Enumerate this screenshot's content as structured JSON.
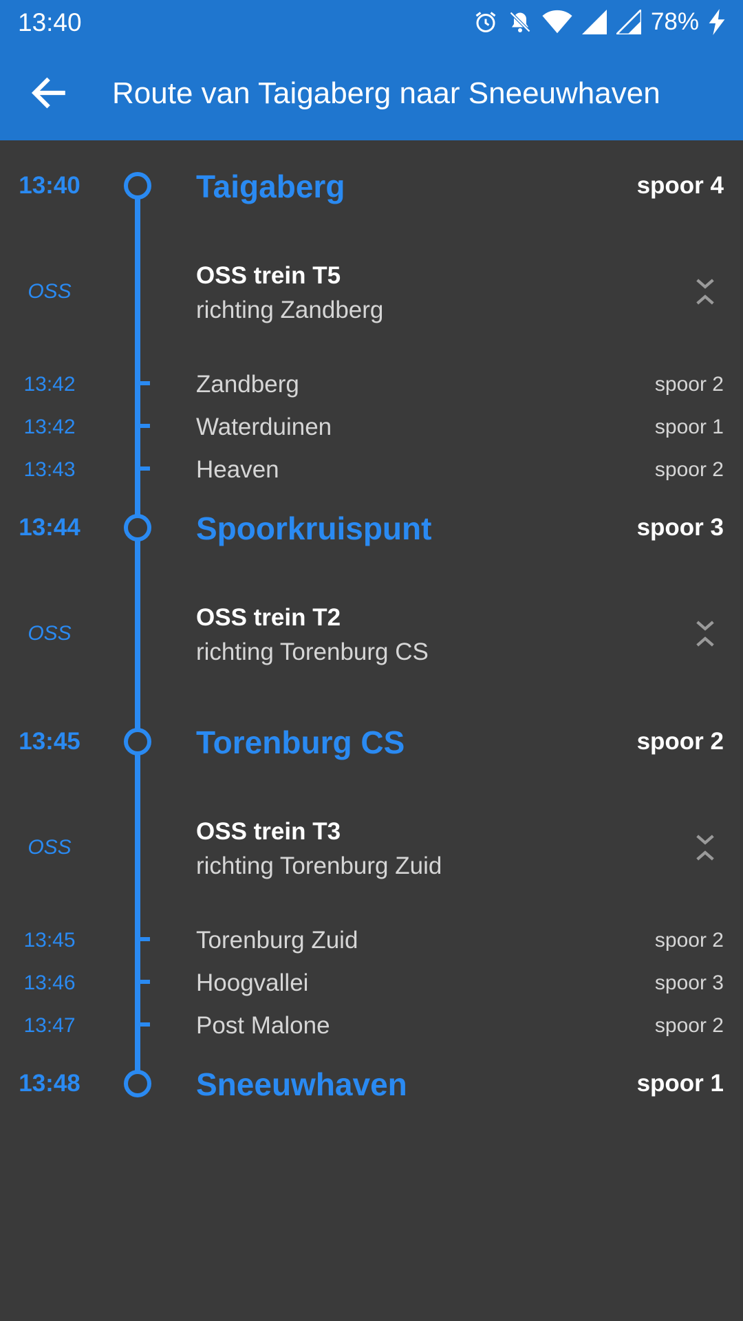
{
  "status_bar": {
    "time": "13:40",
    "battery_percent": "78%",
    "icons": [
      "alarm-icon",
      "bell-off-icon",
      "wifi-icon",
      "signal-icon",
      "signal-icon",
      "charging-icon"
    ]
  },
  "app_bar": {
    "title": "Route van Taigaberg naar Sneeuwhaven",
    "back_icon": "arrow-left-icon"
  },
  "colors": {
    "app_bar": "#1f76cf",
    "accent": "#2a8af2",
    "background": "#3a3a3a",
    "text_primary": "#ffffff",
    "text_secondary": "#d6d6d6"
  },
  "route": {
    "stop1": {
      "time": "13:40",
      "name": "Taigaberg",
      "platform": "spoor 4"
    },
    "leg1": {
      "operator": "OSS",
      "train": "OSS trein T5",
      "direction": "richting Zandberg",
      "stops": [
        {
          "time": "13:42",
          "name": "Zandberg",
          "platform": "spoor 2"
        },
        {
          "time": "13:42",
          "name": "Waterduinen",
          "platform": "spoor 1"
        },
        {
          "time": "13:43",
          "name": "Heaven",
          "platform": "spoor 2"
        }
      ]
    },
    "stop2": {
      "time": "13:44",
      "name": "Spoorkruispunt",
      "platform": "spoor 3"
    },
    "leg2": {
      "operator": "OSS",
      "train": "OSS trein T2",
      "direction": "richting Torenburg CS"
    },
    "stop3": {
      "time": "13:45",
      "name": "Torenburg CS",
      "platform": "spoor 2"
    },
    "leg3": {
      "operator": "OSS",
      "train": "OSS trein T3",
      "direction": "richting Torenburg Zuid",
      "stops": [
        {
          "time": "13:45",
          "name": "Torenburg Zuid",
          "platform": "spoor 2"
        },
        {
          "time": "13:46",
          "name": "Hoogvallei",
          "platform": "spoor 3"
        },
        {
          "time": "13:47",
          "name": "Post Malone",
          "platform": "spoor 2"
        }
      ]
    },
    "stop4": {
      "time": "13:48",
      "name": "Sneeuwhaven",
      "platform": "spoor 1"
    }
  }
}
